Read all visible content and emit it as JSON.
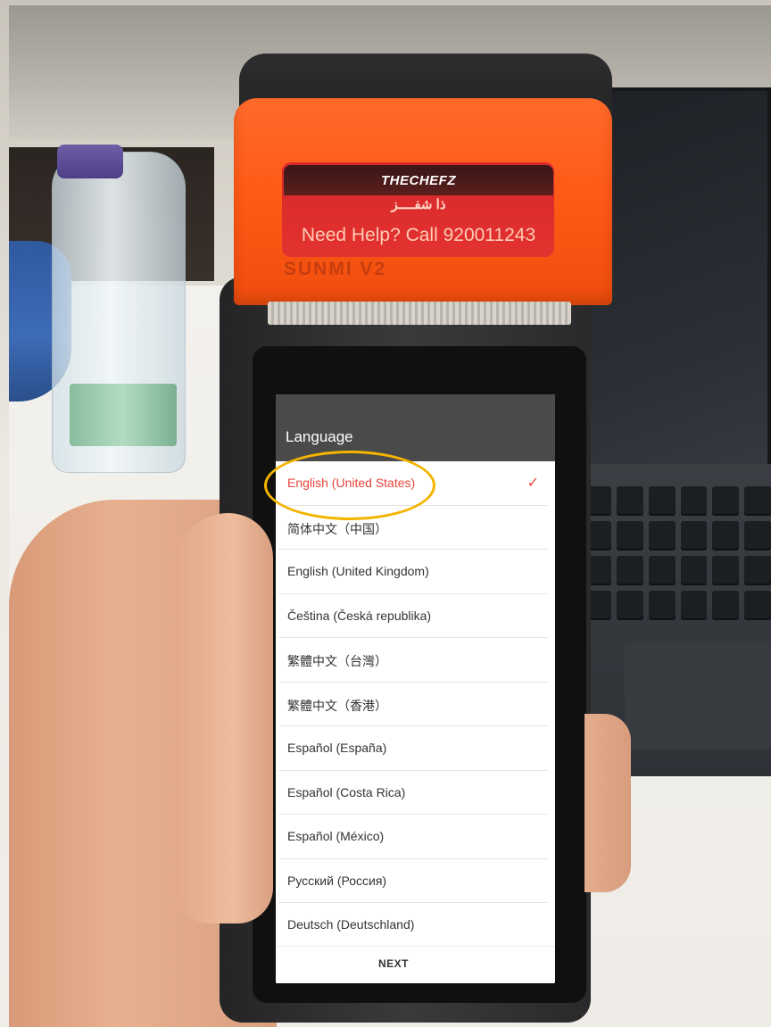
{
  "printer_label": {
    "brand": "THECHEFZ",
    "arabic_name": "ذا شفــــز",
    "help_text": "Need Help? Call 920011243",
    "model": "SUNMI V2"
  },
  "screen": {
    "title": "Language",
    "languages": [
      {
        "label": "English (United States)",
        "selected": true
      },
      {
        "label": "简体中文（中国）",
        "selected": false
      },
      {
        "label": "English (United Kingdom)",
        "selected": false
      },
      {
        "label": "Čeština (Česká republika)",
        "selected": false
      },
      {
        "label": "繁體中文（台灣）",
        "selected": false
      },
      {
        "label": "繁體中文（香港）",
        "selected": false
      },
      {
        "label": "Español (España)",
        "selected": false
      },
      {
        "label": "Español (Costa Rica)",
        "selected": false
      },
      {
        "label": "Español (México)",
        "selected": false
      },
      {
        "label": "Русский (Россия)",
        "selected": false
      },
      {
        "label": "Deutsch (Deutschland)",
        "selected": false
      }
    ],
    "check_glyph": "✓",
    "next_label": "NEXT"
  },
  "colors": {
    "selected_text": "#e8443a",
    "header_bg": "#4a4a4a",
    "printer_orange": "#ff5a17",
    "annotation_ring": "#f4b400"
  }
}
